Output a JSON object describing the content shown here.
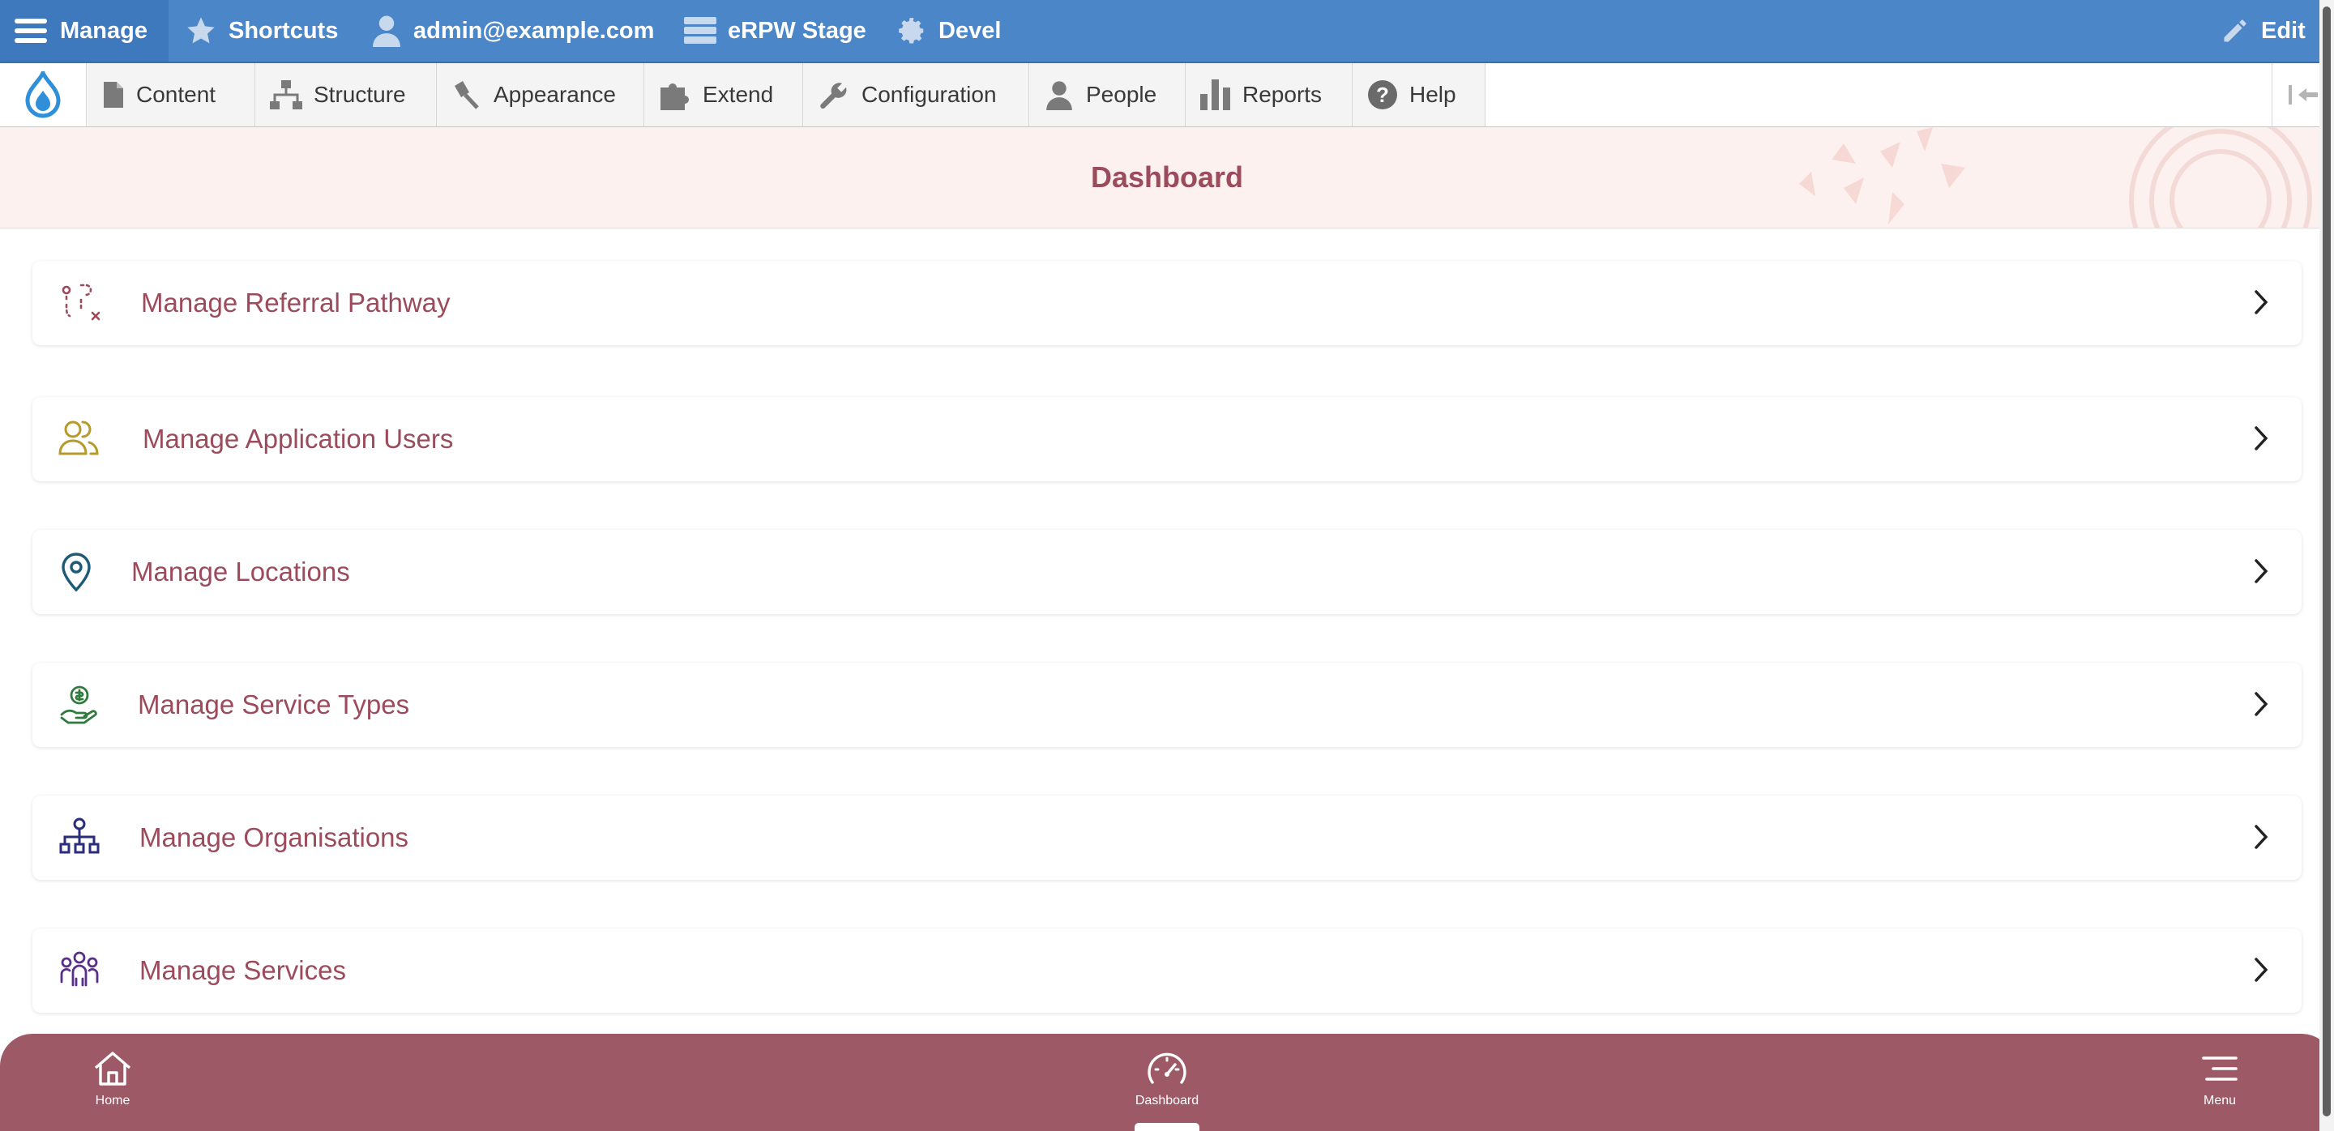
{
  "toolbar": {
    "manage": "Manage",
    "shortcuts": "Shortcuts",
    "user": "admin@example.com",
    "site": "eRPW Stage",
    "devel": "Devel",
    "edit": "Edit"
  },
  "tray": {
    "items": [
      {
        "label": "Content",
        "icon": "file-icon"
      },
      {
        "label": "Structure",
        "icon": "sitemap-icon"
      },
      {
        "label": "Appearance",
        "icon": "paintbrush-icon"
      },
      {
        "label": "Extend",
        "icon": "puzzle-icon"
      },
      {
        "label": "Configuration",
        "icon": "wrench-icon"
      },
      {
        "label": "People",
        "icon": "person-icon"
      },
      {
        "label": "Reports",
        "icon": "bar-chart-icon"
      },
      {
        "label": "Help",
        "icon": "question-icon"
      }
    ]
  },
  "header": {
    "title": "Dashboard"
  },
  "cards": [
    {
      "label": "Manage Referral Pathway",
      "icon": "route-icon"
    },
    {
      "label": "Manage Application Users",
      "icon": "users-icon"
    },
    {
      "label": "Manage Locations",
      "icon": "map-pin-icon"
    },
    {
      "label": "Manage Service Types",
      "icon": "hand-coin-icon"
    },
    {
      "label": "Manage Organisations",
      "icon": "org-chart-icon"
    },
    {
      "label": "Manage Services",
      "icon": "group-icon"
    }
  ],
  "bottom_nav": {
    "home": "Home",
    "dashboard": "Dashboard",
    "menu": "Menu"
  },
  "colors": {
    "admin_bar": "#4b87c8",
    "accent": "#9b4b5b",
    "bottom_nav": "#9e5967",
    "header_bg": "#fdf1ef"
  }
}
